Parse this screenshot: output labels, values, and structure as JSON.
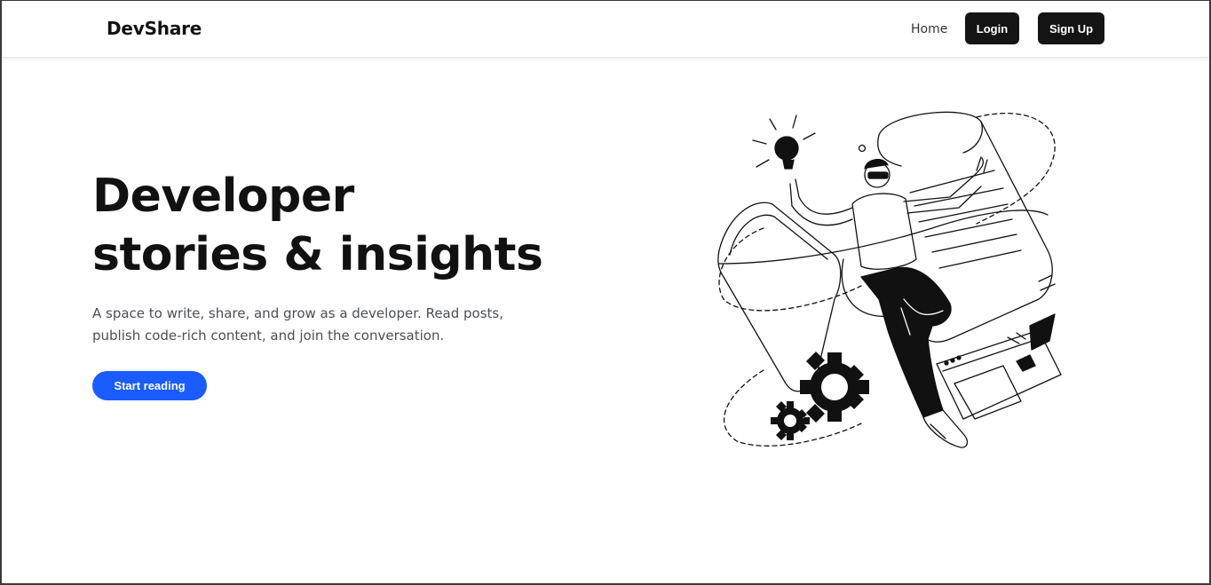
{
  "nav": {
    "brand": "DevShare",
    "home": "Home",
    "login": "Login",
    "signup": "Sign Up"
  },
  "hero": {
    "title_line1": "Developer",
    "title_line2": "stories & insights",
    "subtitle": "A space to write, share, and grow as a developer. Read posts, publish code-rich content, and join the conversation.",
    "cta": "Start reading"
  },
  "colors": {
    "accent": "#1a5cff",
    "dark_button": "#141414",
    "text": "#111111",
    "muted": "#4a4f57"
  },
  "icons": [
    "developer-illustration",
    "lightbulb-icon",
    "gear-icon"
  ]
}
